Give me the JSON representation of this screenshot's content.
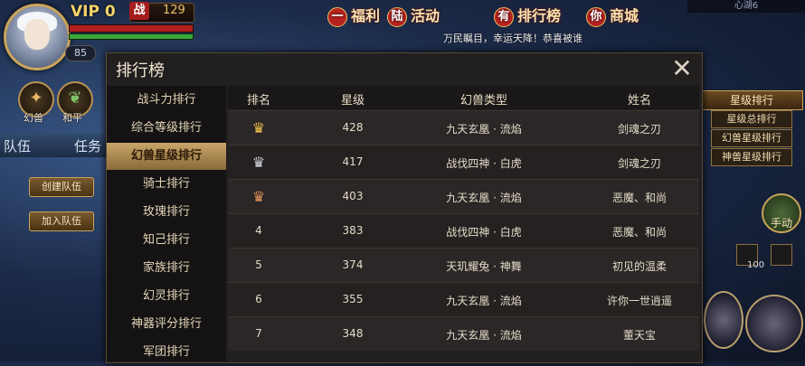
{
  "hud": {
    "vip": "VIP 0",
    "fight_icon": "战",
    "fight_value": "129",
    "level": "85",
    "hp_fraction": 1.0,
    "mp_fraction": 1.0,
    "buttons": [
      {
        "label": "幻兽",
        "icon": "beast-icon"
      },
      {
        "label": "和平",
        "icon": "peace-icon"
      }
    ],
    "tabs": [
      "队伍",
      "任务"
    ],
    "create_team": "创建队伍",
    "join_team": "加入队伍"
  },
  "top_menu": [
    {
      "badge": "一",
      "label": "福利"
    },
    {
      "badge": "陆",
      "label": "活动"
    },
    {
      "badge": "有",
      "label": "排行榜"
    },
    {
      "badge": "你",
      "label": "商城"
    }
  ],
  "broadcast": "万民瞩目，幸运天降！恭喜被谁",
  "server": "心湖6",
  "right_hud": {
    "rank_dropdown": "星级排行",
    "rank_options": [
      "星级总排行",
      "幻兽星级排行",
      "神兽星级排行"
    ],
    "auto_label": "手动",
    "slot_count": "100"
  },
  "panel": {
    "title": "排行榜",
    "close_icon": "close-icon",
    "categories": [
      "战斗力排行",
      "综合等级排行",
      "幻兽星级排行",
      "骑士排行",
      "玫瑰排行",
      "知己排行",
      "家族排行",
      "幻灵排行",
      "神器评分排行",
      "军团排行"
    ],
    "active_index": 2,
    "headers": [
      "排名",
      "星级",
      "幻兽类型",
      "姓名"
    ],
    "rows": [
      {
        "rank": "",
        "medal": "gold",
        "star": "428",
        "type": "九天玄凰 · 流焰",
        "name": "剑魂之刃"
      },
      {
        "rank": "",
        "medal": "silver",
        "star": "417",
        "type": "战伐四神 · 白虎",
        "name": "剑魂之刃"
      },
      {
        "rank": "",
        "medal": "bronze",
        "star": "403",
        "type": "九天玄凰 · 流焰",
        "name": "恶魔、和尚"
      },
      {
        "rank": "4",
        "medal": "",
        "star": "383",
        "type": "战伐四神 · 白虎",
        "name": "恶魔、和尚"
      },
      {
        "rank": "5",
        "medal": "",
        "star": "374",
        "type": "天玑耀兔 · 神舞",
        "name": "初见的温柔"
      },
      {
        "rank": "6",
        "medal": "",
        "star": "355",
        "type": "九天玄凰 · 流焰",
        "name": "许你一世逍遥"
      },
      {
        "rank": "7",
        "medal": "",
        "star": "348",
        "type": "九天玄凰 · 流焰",
        "name": "董天宝"
      }
    ],
    "medal_colors": {
      "gold": "#f2c14e",
      "silver": "#d7dbe2",
      "bronze": "#e0955a"
    }
  }
}
